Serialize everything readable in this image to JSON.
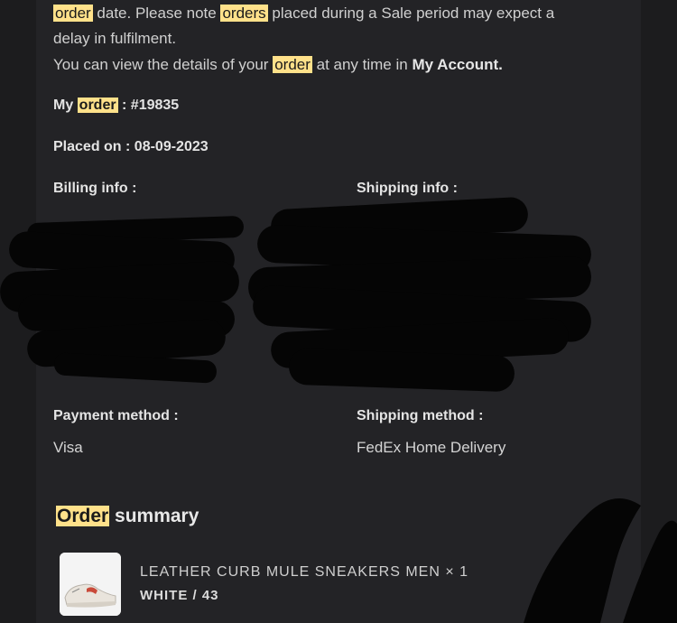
{
  "intro": {
    "line1_hl": "order",
    "line1_rest": " date. Please note ",
    "line1_hl2": "orders",
    "line1_end": " placed during a Sale period may expect a",
    "line2": "delay in fulfilment.",
    "line3_start": "You can view the details of your ",
    "line3_hl": "order",
    "line3_mid": " at any time in ",
    "line3_link": "My Account."
  },
  "order": {
    "label_pre": "My ",
    "label_hl": "order",
    "label_post": " : #19835",
    "placed": "Placed on : 08-09-2023"
  },
  "billing": {
    "label": "Billing info :"
  },
  "shipping": {
    "label": "Shipping info :"
  },
  "payment": {
    "label": "Payment method :",
    "value": "Visa"
  },
  "shipping_method": {
    "label": "Shipping method :",
    "value": "FedEx Home Delivery"
  },
  "summary": {
    "hl": "Order",
    "rest": " summary"
  },
  "product": {
    "name": "LEATHER CURB MULE SNEAKERS MEN × 1",
    "variant": "WHITE / 43",
    "image_icon": "sneaker-image"
  },
  "colors": {
    "highlight": "#ffe18a",
    "background": "#1c1c1e",
    "panel": "#232326"
  }
}
